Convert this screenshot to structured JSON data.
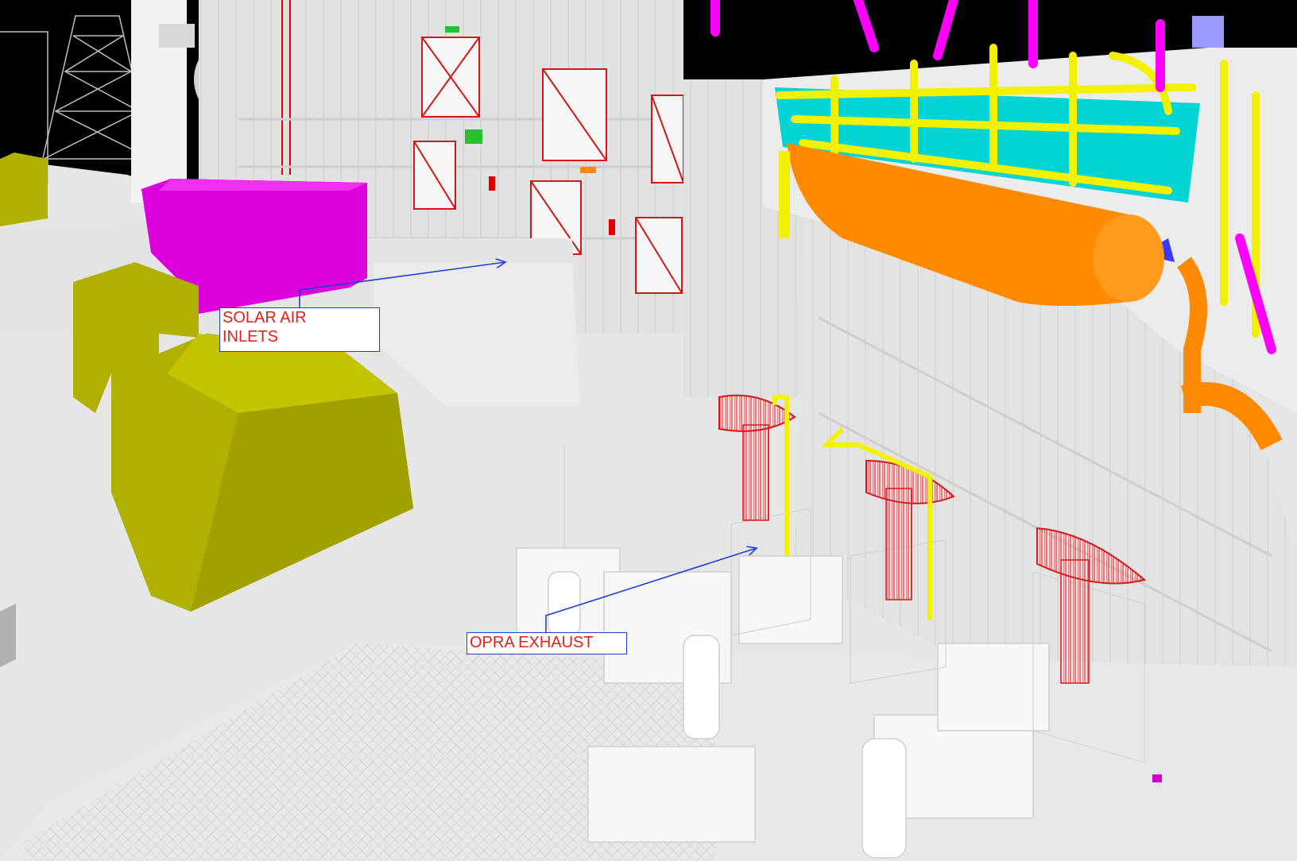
{
  "labels": {
    "solar_air_inlets": {
      "line1": "SOLAR AIR",
      "line2": "INLETS"
    },
    "opra_exhaust": "OPRA EXHAUST"
  },
  "colors": {
    "background": "#e9e9e9",
    "sky": "#000000",
    "wall": "#e0e0e0",
    "deck": "#ececec",
    "magenta_block": "#dc00dc",
    "olive_blocks": "#b0b000",
    "orange_vessel": "#ff8a00",
    "yellow_pipework": "#f2f200",
    "cyan_deck": "#00d6d6",
    "exhaust_red": "#d8161b",
    "callout_border": "#1f3fd6",
    "callout_text": "#e0201a",
    "leader_line": "#1f3fd6"
  }
}
